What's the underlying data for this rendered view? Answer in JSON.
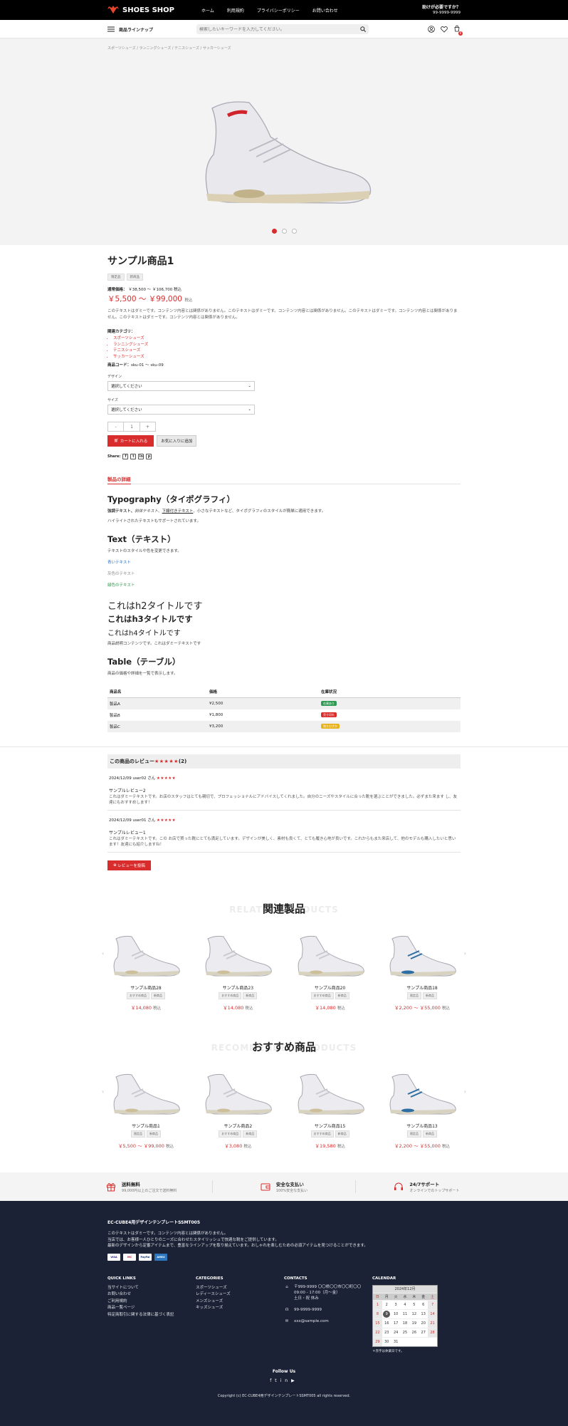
{
  "header": {
    "brand": "SHOES SHOP",
    "nav": [
      "ホーム",
      "利用規約",
      "プライバシーポリシー",
      "お問い合わせ"
    ],
    "help_title": "助けが必要ですか？",
    "help_phone": "99-9999-9999"
  },
  "searchbar": {
    "lineup_label": "商品ラインナップ",
    "placeholder": "検索したいキーワードを入力してください。",
    "cart_count": "0"
  },
  "breadcrumb": [
    "スポーツシューズ",
    "ランニングシューズ",
    "テニスシューズ",
    "サッカーシューズ"
  ],
  "product": {
    "name": "サンプル商品1",
    "tags": [
      "限定品",
      "新商品"
    ],
    "regular_price_label": "通常価格：",
    "regular_price": "￥38,500 〜 ￥106,700",
    "tax_label": "税込",
    "price": "￥5,500 〜 ￥99,000",
    "description": "このテキストはダミーです。コンテンツ内容とは関係がありません。このテキストはダミーです。コンテンツ内容とは関係がありません。このテキストはダミーです。コンテンツ内容とは関係がありません。このテキストはダミーです。コンテンツ内容とは関係がありません。",
    "category_label": "関連カテゴリ：",
    "categories": [
      "スポーツシューズ",
      "ランニングシューズ",
      "テニスシューズ",
      "サッカーシューズ"
    ],
    "code_label": "商品コード：",
    "code": "sku-01 〜 sku-09",
    "design_label": "デザイン",
    "design_value": "選択してください",
    "size_label": "サイズ",
    "size_value": "選択してください",
    "qty_minus": "-",
    "qty": "1",
    "qty_plus": "+",
    "add_to_cart": "カートに入れる",
    "add_favorite": "お気に入りに追加",
    "share_label": "Share:"
  },
  "details": {
    "tab": "製品の詳細",
    "typography_title": "Typography（タイポグラフィ）",
    "typography_text_a": "強調テキスト、",
    "typography_text_b": "斜体テキスト",
    "typography_text_c": "、",
    "typography_text_u": "下線付きテキスト",
    "typography_text_d": "、小さなテキストなど、タイポグラフィのスタイルが簡単に適用できます。",
    "highlight_text": "ハイライトされたテキストもサポートされています。",
    "text_title": "Text（テキスト）",
    "text_desc": "テキストのスタイルや色を変更できます。",
    "blue_text": "青いテキスト",
    "gray_text": "灰色のテキスト",
    "green_text": "緑色のテキスト",
    "h2": "これはh2タイトルです",
    "h3": "これはh3タイトルです",
    "h4": "これはh4タイトルです",
    "dummy": "商品説明コンテンツです。これはダミーテキストです",
    "table_title": "Table（テーブル）",
    "table_desc": "商品の価格や詳細を一覧で表示します。",
    "table_headers": [
      "商品名",
      "価格",
      "在庫状況"
    ],
    "table_rows": [
      {
        "name": "製品A",
        "price": "¥2,500",
        "stock": "在庫あり",
        "color": "#2e9a52"
      },
      {
        "name": "製品B",
        "price": "¥1,800",
        "stock": "売り切れ",
        "color": "#d92c2c"
      },
      {
        "name": "製品C",
        "price": "¥3,200",
        "stock": "残りわずか",
        "color": "#e8b21f"
      }
    ]
  },
  "reviews": {
    "title": "この商品のレビュー",
    "stars": "★★★★★",
    "count": "(2)",
    "items": [
      {
        "date": "2024/12/09",
        "user": "user02 さん",
        "stars": "★★★★★",
        "title": "サンプルレビュー2",
        "text": "これはダミーテキストです。お店のスタッフはとても親切で、プロフェッショナルにアドバイスしてくれました。自分のニーズやスタイルに合った靴を選ぶことができました。必ずまた来ます し、友達にもおすすめします！"
      },
      {
        "date": "2024/12/09",
        "user": "user01 さん",
        "stars": "★★★★★",
        "title": "サンプルレビュー1",
        "text": "これはダミーテキストです。この お店で買った靴にとても満足しています。デザインが美しく、素材も良くて、とても履き心地が良いです。これからもまた来店して、他のモデルも購入したいと思います！友達にも紹介しますね！"
      }
    ],
    "post_button": "レビューを投稿"
  },
  "related": {
    "title": "関連製品",
    "ghost": "RELATED PRODUCTS",
    "items": [
      {
        "name": "サンプル商品28",
        "tags": [
          "おすすめ商品",
          "新商品"
        ],
        "price": "￥14,080"
      },
      {
        "name": "サンプル商品23",
        "tags": [
          "おすすめ商品",
          "新商品"
        ],
        "price": "￥14,080"
      },
      {
        "name": "サンプル商品20",
        "tags": [
          "おすすめ商品",
          "新商品"
        ],
        "price": "￥14,080"
      },
      {
        "name": "サンプル商品18",
        "tags": [
          "限定品",
          "新商品"
        ],
        "price": "￥2,200 〜 ￥55,000"
      }
    ]
  },
  "recommended": {
    "title": "おすすめ商品",
    "ghost": "RECOMMENDED PRODUCTS",
    "items": [
      {
        "name": "サンプル商品1",
        "tags": [
          "限定品",
          "新商品"
        ],
        "price": "￥5,500 〜 ￥99,000"
      },
      {
        "name": "サンプル商品2",
        "tags": [
          "おすすめ商品",
          "新商品"
        ],
        "price": "￥3,080"
      },
      {
        "name": "サンプル商品15",
        "tags": [
          "おすすめ商品",
          "新商品"
        ],
        "price": "￥19,580"
      },
      {
        "name": "サンプル商品13",
        "tags": [
          "限定品",
          "新商品"
        ],
        "price": "￥2,200 〜 ￥55,000"
      }
    ]
  },
  "features": [
    {
      "title": "送料無料",
      "sub": "99,000円以上のご注文で送料無料",
      "icon": "gift-icon"
    },
    {
      "title": "安全な支払い",
      "sub": "100%安全な支払い",
      "icon": "wallet-icon"
    },
    {
      "title": "24/7サポート",
      "sub": "オンラインでのトップサポート",
      "icon": "headset-icon"
    }
  ],
  "footer": {
    "title": "EC-CUBE4用デザインテンプレートSSMT005",
    "text1": "このテキストはダミーです。コンテンツ内容とは関係がありません。",
    "text2": "当店では、お客様一人ひとりのニーズに合わせたスタイリッシュで快適な靴をご提供しています。",
    "text3": "最新のデザインから定番アイテムまで、豊富なラインアップを取り揃えています。おしゃれを楽しむための必須アイテムを見つけることができます。",
    "payments": [
      "VISA",
      "MC",
      "PayPal",
      "AMEX"
    ],
    "quick_title": "QUICK LINKS",
    "quick": [
      "当サイトについて",
      "お問い合わせ",
      "ご利用規約",
      "商品一覧ページ",
      "特定商取引に関する法律に基づく表記"
    ],
    "cat_title": "CATEGORIES",
    "cats": [
      "スポーツシューズ",
      "レディースシューズ",
      "メンズシューズ",
      "キッズシューズ"
    ],
    "contact_title": "CONTACTS",
    "address": "〒999-9999 〇〇県〇〇市〇〇町〇〇",
    "hours": "09:00 - 17:00（月〜金）",
    "holiday": "土日・祝 休み",
    "phone": "99-9999-9999",
    "email": "xxx@sample.com",
    "calendar_title": "CALENDAR",
    "calendar_month": "2024年12月",
    "weekdays": [
      "日",
      "月",
      "火",
      "水",
      "木",
      "金",
      "土"
    ],
    "calendar_note": "＊赤字は休業日です。",
    "follow": "Follow Us",
    "copyright": "Copyright (c) EC-CUBE4用デザインテンプレートSSMT005 all rights reserved."
  }
}
